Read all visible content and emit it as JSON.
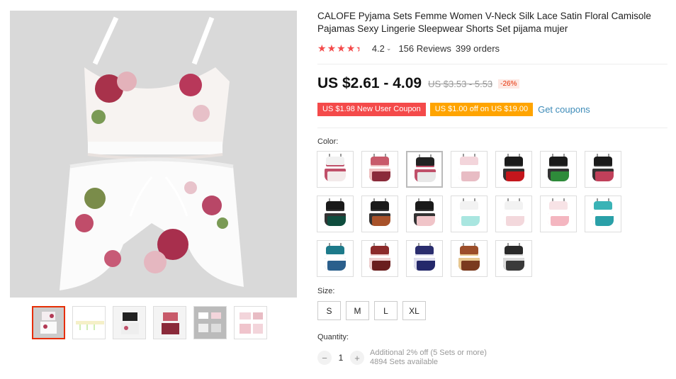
{
  "product": {
    "title": "CALOFE Pyjama Sets Femme Women V-Neck Silk Lace Satin Floral Camisole Pajamas Sexy Lingerie Sleepwear Shorts Set pijama mujer",
    "rating": "4.2",
    "reviews": "156 Reviews",
    "orders": "399 orders",
    "stars_value": 4.2
  },
  "price": {
    "current": "US $2.61 - 4.09",
    "original": "US $3.53 - 5.53",
    "discount": "-26%"
  },
  "coupons": {
    "new_user": "US $1.98 New User Coupon",
    "off": "US $1.00 off on US $19.00",
    "get": "Get coupons"
  },
  "color": {
    "label": "Color:",
    "swatches": [
      {
        "top": "#f1f1f1",
        "bot": "#f3eaea",
        "accent": "#c0506a"
      },
      {
        "top": "#c85a6a",
        "bot": "#8a2a3a",
        "accent": "#f0c0c0"
      },
      {
        "top": "#222222",
        "bot": "#e8e8e8",
        "accent": "#c0506a"
      },
      {
        "top": "#f3d5db",
        "bot": "#e8bcc4",
        "accent": "#ffffff"
      },
      {
        "top": "#1a1a1a",
        "bot": "#c4161c",
        "accent": "#333333"
      },
      {
        "top": "#1a1a1a",
        "bot": "#2e8b3a",
        "accent": "#333333"
      },
      {
        "top": "#1a1a1a",
        "bot": "#c0405a",
        "accent": "#333333"
      },
      {
        "top": "#1a1a1a",
        "bot": "#0f4d3e",
        "accent": "#333333"
      },
      {
        "top": "#1a1a1a",
        "bot": "#a8522a",
        "accent": "#333333"
      },
      {
        "top": "#1a1a1a",
        "bot": "#f0c4c8",
        "accent": "#333333"
      },
      {
        "top": "#f2f2f2",
        "bot": "#a9e6e0",
        "accent": "#ffffff"
      },
      {
        "top": "#f2f2f2",
        "bot": "#f3d8dc",
        "accent": "#ffffff"
      },
      {
        "top": "#f7e3e6",
        "bot": "#f4b6c0",
        "accent": "#ffffff"
      },
      {
        "top": "#3ab3b6",
        "bot": "#2aa0a8",
        "accent": "#ffffff"
      },
      {
        "top": "#1d7a8a",
        "bot": "#2b5f8c",
        "accent": "#ffffff"
      },
      {
        "top": "#8c2a2a",
        "bot": "#6a1e1e",
        "accent": "#f0d0d0"
      },
      {
        "top": "#2a2d6e",
        "bot": "#24286a",
        "accent": "#e0e0f0"
      },
      {
        "top": "#9c4e2a",
        "bot": "#7a3a1e",
        "accent": "#e8c890"
      },
      {
        "top": "#2a2a2a",
        "bot": "#3a3a3a",
        "accent": "#dddddd"
      }
    ],
    "selected_index": 2
  },
  "size": {
    "label": "Size:",
    "options": [
      "S",
      "M",
      "L",
      "XL"
    ]
  },
  "quantity": {
    "label": "Quantity:",
    "value": "1",
    "minus": "−",
    "plus": "+",
    "discount_note": "Additional 2% off (5 Sets or more)",
    "available": "4894 Sets available"
  },
  "thumbnails_count": 6,
  "colors": {
    "accent_red": "#f44a4a",
    "coupon_orange": "#ffa400",
    "link_blue": "#3d8bb8"
  }
}
